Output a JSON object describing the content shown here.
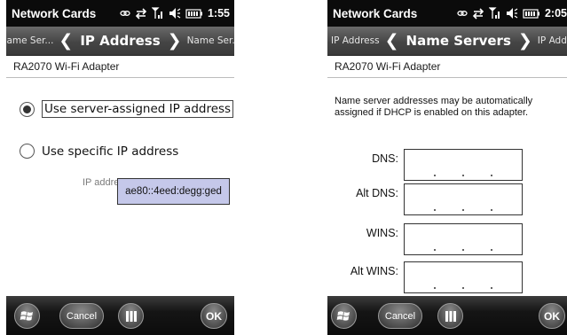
{
  "left": {
    "statusbar": {
      "title": "Network Cards",
      "time": "1:55"
    },
    "nav": {
      "prev": "Name Ser...",
      "current": "IP Address",
      "next": "Name Ser..."
    },
    "adapter": "RA2070 Wi-Fi Adapter",
    "options": [
      {
        "label": "Use server-assigned IP address",
        "selected": true
      },
      {
        "label": "Use specific IP address",
        "selected": false
      }
    ],
    "ip_label": "IP address:",
    "ip_value": "ae80::4eed:degg:ged",
    "buttons": {
      "cancel": "Cancel",
      "ok": "OK"
    }
  },
  "right": {
    "statusbar": {
      "title": "Network Cards",
      "time": "2:05"
    },
    "nav": {
      "prev": "IP Address",
      "current": "Name Servers",
      "next": "IP Address"
    },
    "adapter": "RA2070 Wi-Fi Adapter",
    "info_line1": "Name server addresses may be automatically",
    "info_line2": "assigned if DHCP is enabled on this adapter.",
    "fields": [
      "DNS:",
      "Alt DNS:",
      "WINS:",
      "Alt WINS:"
    ],
    "buttons": {
      "cancel": "Cancel",
      "ok": "OK"
    }
  },
  "colors": {
    "ip_field_bg": "#c5c8ea",
    "titlebar": "#0b0b0b"
  },
  "icons": [
    "windows-start-icon",
    "keyboard-icon",
    "signal-icon",
    "speaker-icon",
    "battery-icon",
    "sync-icon",
    "link-icon"
  ]
}
